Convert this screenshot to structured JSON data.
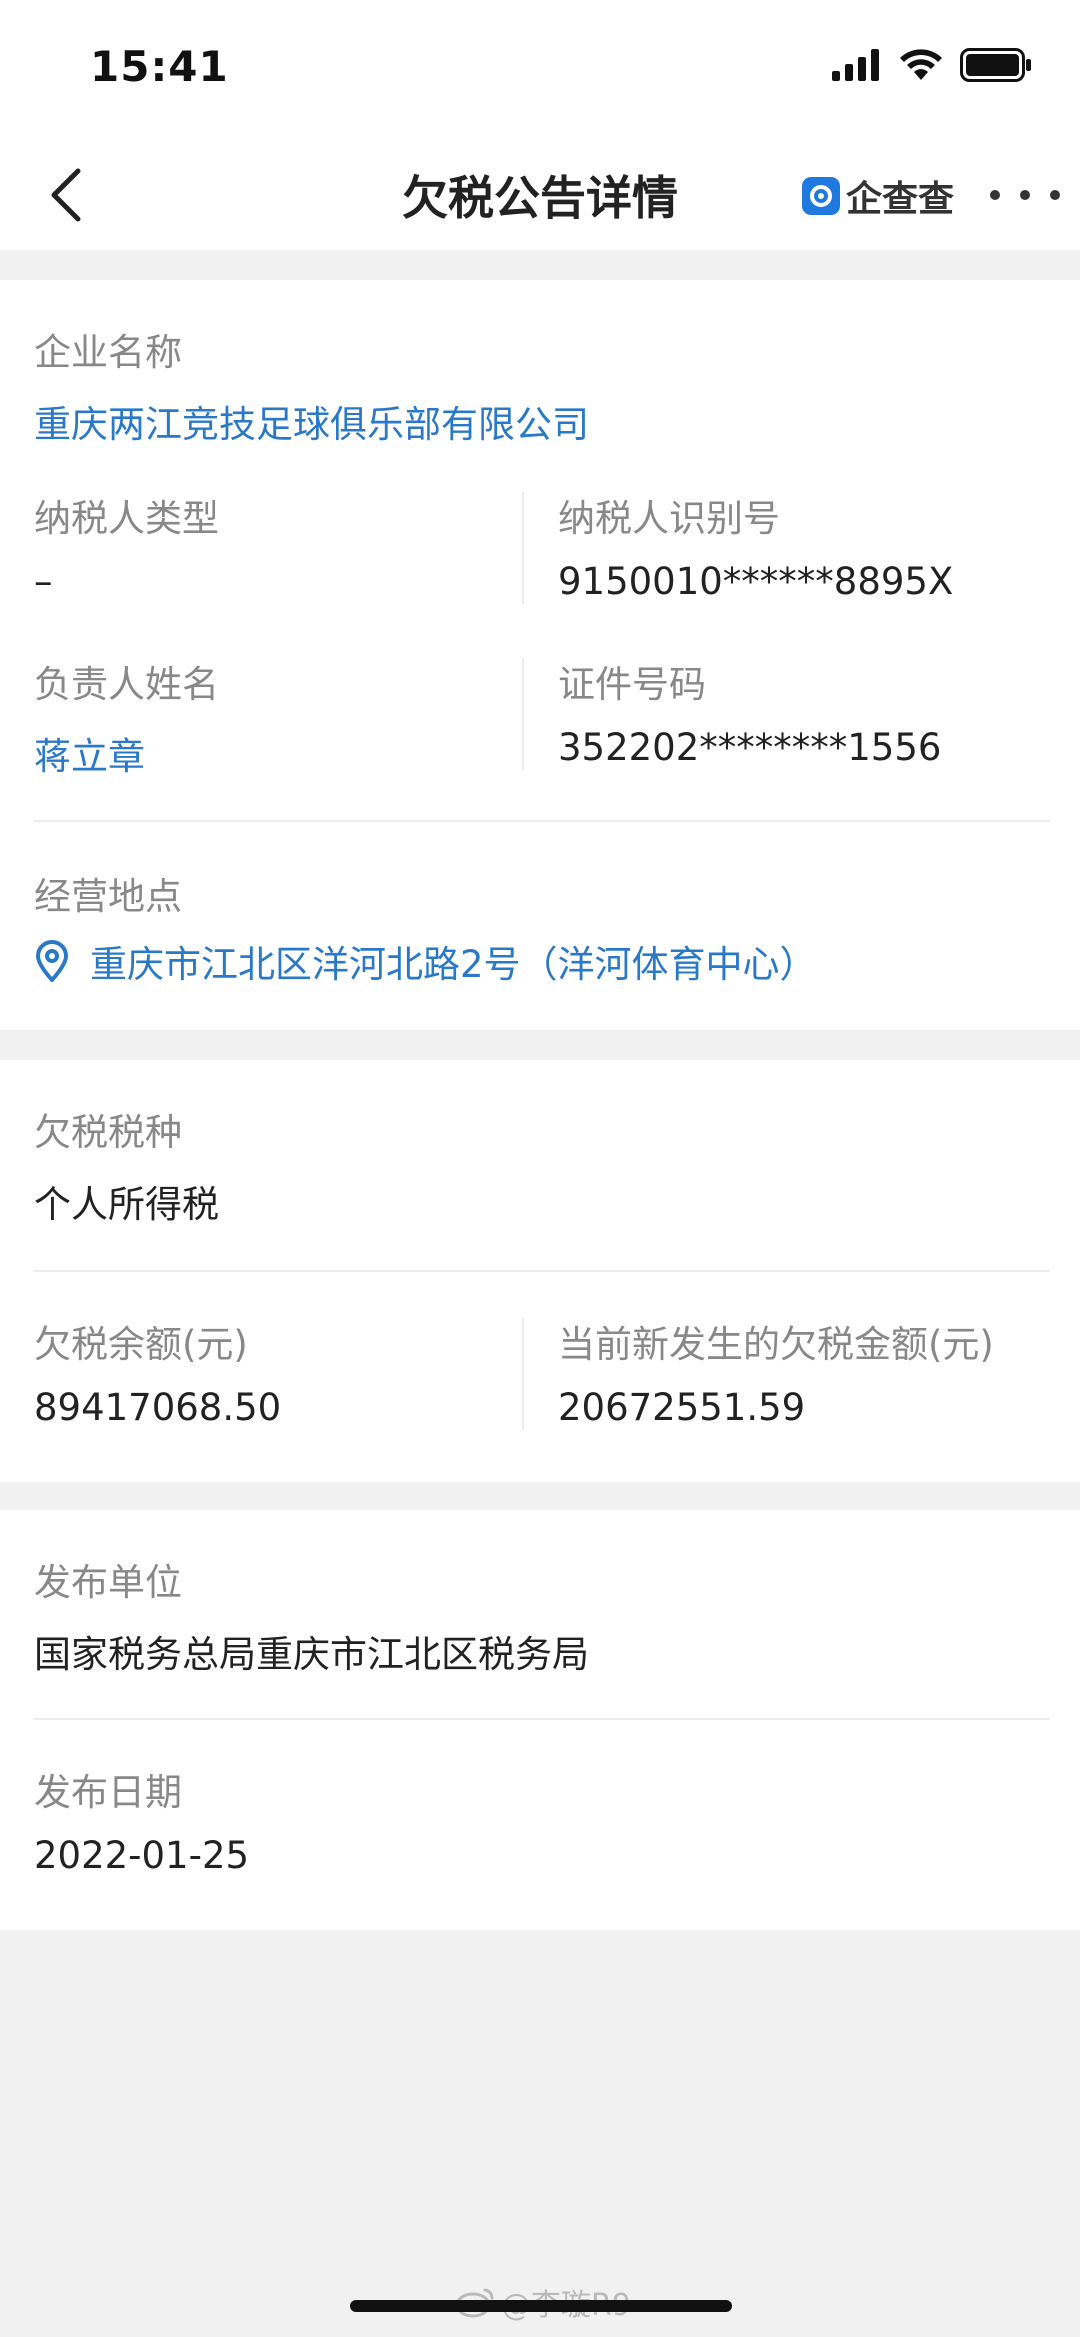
{
  "status_bar": {
    "time": "15:41",
    "icons": [
      "signal-icon",
      "wifi-icon",
      "battery-icon"
    ]
  },
  "nav": {
    "title": "欠税公告详情",
    "brand": "企查查",
    "icons": [
      "back-icon",
      "brand-logo",
      "more-icon"
    ]
  },
  "company": {
    "name_label": "企业名称",
    "name": "重庆两江竞技足球俱乐部有限公司",
    "taxpayer_type_label": "纳税人类型",
    "taxpayer_type": "–",
    "taxpayer_id_label": "纳税人识别号",
    "taxpayer_id": "9150010******8895X",
    "person_label": "负责人姓名",
    "person": "蒋立章",
    "cert_label": "证件号码",
    "cert_no": "352202********1556",
    "location_label": "经营地点",
    "location": "重庆市江北区洋河北路2号（洋河体育中心）"
  },
  "tax": {
    "type_label": "欠税税种",
    "type": "个人所得税",
    "balance_label": "欠税余额(元)",
    "balance": "89417068.50",
    "new_label": "当前新发生的欠税金额(元)",
    "new_amount": "20672551.59"
  },
  "publish": {
    "unit_label": "发布单位",
    "unit": "国家税务总局重庆市江北区税务局",
    "date_label": "发布日期",
    "date": "2022-01-25"
  },
  "watermark": "@李璇R9",
  "colors": {
    "link": "#2a79c9",
    "label": "#888888",
    "background": "#f1f1f1",
    "brand": "#1f7ae0"
  }
}
